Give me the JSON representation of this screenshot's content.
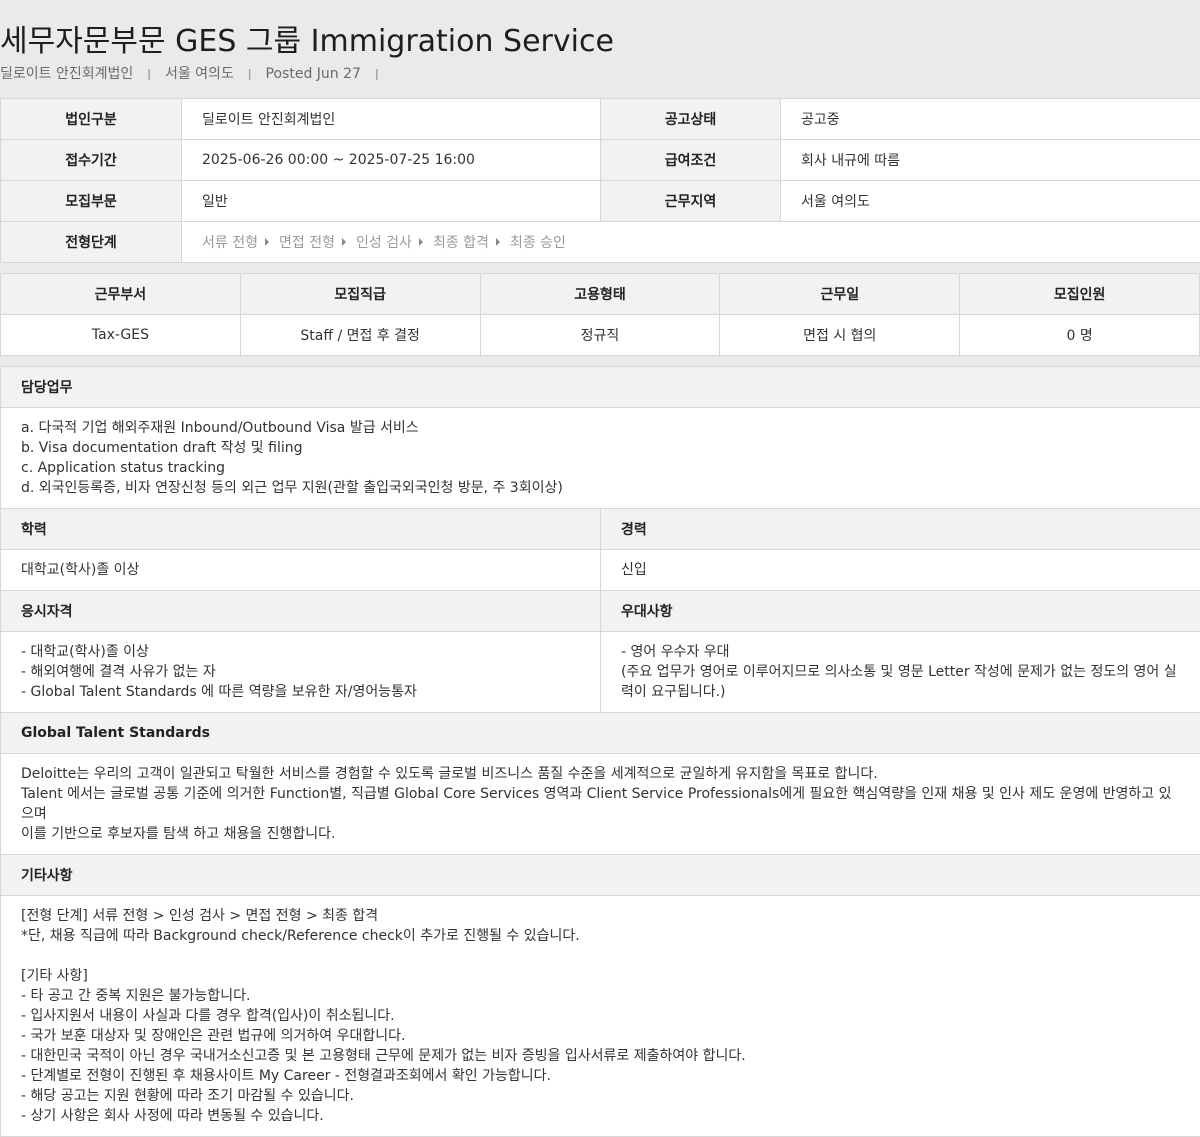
{
  "header": {
    "title": "세무자문부문 GES 그룹 Immigration Service",
    "company": "딜로이트 안진회계법인",
    "location": "서울 여의도",
    "posted": "Posted Jun 27",
    "separator": "|"
  },
  "info": {
    "rows": [
      {
        "l1": "법인구분",
        "v1": "딜로이트 안진회계법인",
        "l2": "공고상태",
        "v2": "공고중"
      },
      {
        "l1": "접수기간",
        "v1": "2025-06-26 00:00 ~ 2025-07-25 16:00",
        "l2": "급여조건",
        "v2": "회사 내규에 따름"
      },
      {
        "l1": "모집부문",
        "v1": "일반",
        "l2": "근무지역",
        "v2": "서울 여의도"
      }
    ],
    "stage_label": "전형단계",
    "stages": [
      "서류 전형",
      "면접 전형",
      "인성 검사",
      "최종 합격",
      "최종 승인"
    ]
  },
  "positions": {
    "headers": [
      "근무부서",
      "모집직급",
      "고용형태",
      "근무일",
      "모집인원"
    ],
    "values": [
      "Tax-GES",
      "Staff / 면접 후 결정",
      "정규직",
      "면접 시 협의",
      "0 명"
    ]
  },
  "duties": {
    "title": "담당업무",
    "lines": [
      "a. 다국적 기업 해외주재원 Inbound/Outbound Visa 발급 서비스",
      "b. Visa documentation draft 작성 및 filing",
      "c. Application status tracking",
      "d. 외국인등록증, 비자 연장신청 등의 외근 업무 지원(관할 출입국외국인청 방문, 주 3회이상)"
    ]
  },
  "education": {
    "title": "학력",
    "value": "대학교(학사)졸 이상"
  },
  "experience": {
    "title": "경력",
    "value": "신입"
  },
  "qualification": {
    "title": "응시자격",
    "lines": [
      "- 대학교(학사)졸 이상",
      "- 해외여행에 결격 사유가 없는 자",
      "- Global Talent Standards 에 따른 역량을 보유한 자/영어능통자"
    ]
  },
  "preference": {
    "title": "우대사항",
    "lines": [
      "- 영어 우수자 우대",
      "(주요 업무가 영어로 이루어지므로 의사소통 및 영문 Letter 작성에 문제가 없는 정도의 영어 실력이 요구됩니다.)"
    ]
  },
  "gts": {
    "title": "Global Talent Standards",
    "lines": [
      "Deloitte는 우리의 고객이 일관되고 탁월한 서비스를 경험할 수 있도록 글로벌 비즈니스 품질 수준을 세계적으로 균일하게 유지함을 목표로 합니다.",
      "Talent 에서는 글로벌 공통 기준에 의거한 Function별, 직급별 Global Core Services 영역과 Client Service Professionals에게 필요한 핵심역량을 인재 채용 및 인사 제도 운영에 반영하고 있으며",
      "이를 기반으로 후보자를 탐색 하고 채용을 진행합니다."
    ]
  },
  "etc": {
    "title": "기타사항",
    "lines": [
      "[전형 단계] 서류 전형 > 인성 검사 > 면접 전형 > 최종 합격",
      "*단, 채용 직급에 따라 Background check/Reference check이 추가로 진행될 수 있습니다.",
      " ",
      "[기타 사항]",
      "- 타 공고 간 중복 지원은 불가능합니다.",
      "- 입사지원서 내용이 사실과 다를 경우 합격(입사)이 취소됩니다.",
      "- 국가 보훈 대상자 및 장애인은 관련 법규에 의거하여 우대합니다.",
      "- 대한민국 국적이 아닌 경우 국내거소신고증 및 본 고용형태 근무에 문제가 없는 비자 증빙을 입사서류로 제출하여야 합니다.",
      "- 단계별로 전형이 진행된 후 채용사이트 My Career - 전형결과조회에서 확인 가능합니다.",
      "- 해당 공고는 지원 현황에 따라 조기 마감될 수 있습니다.",
      "- 상기 사항은 회사 사정에 따라 변동될 수 있습니다."
    ]
  }
}
